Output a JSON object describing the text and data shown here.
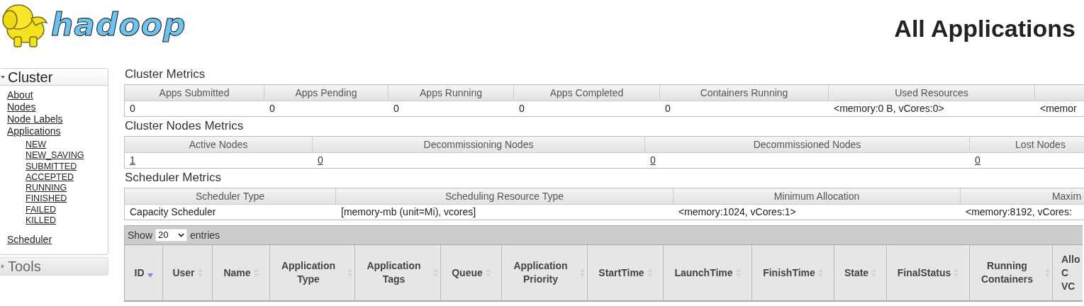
{
  "logo": {
    "text": "hadoop"
  },
  "page_title": "All Applications",
  "sidebar": {
    "sections": [
      {
        "title": "Cluster",
        "expanded": true,
        "items": [
          {
            "label": "About"
          },
          {
            "label": "Nodes"
          },
          {
            "label": "Node Labels"
          },
          {
            "label": "Applications",
            "children": [
              {
                "label": "NEW"
              },
              {
                "label": "NEW_SAVING"
              },
              {
                "label": "SUBMITTED"
              },
              {
                "label": "ACCEPTED"
              },
              {
                "label": "RUNNING"
              },
              {
                "label": "FINISHED"
              },
              {
                "label": "FAILED"
              },
              {
                "label": "KILLED"
              }
            ]
          },
          {
            "label": "Scheduler"
          }
        ]
      },
      {
        "title": "Tools",
        "expanded": false
      }
    ]
  },
  "metrics": [
    {
      "title": "Cluster Metrics",
      "values_are_links": false,
      "columns": [
        "Apps Submitted",
        "Apps Pending",
        "Apps Running",
        "Apps Completed",
        "Containers Running",
        "Used Resources"
      ],
      "row": [
        "0",
        "0",
        "0",
        "0",
        "0",
        "<memory:0 B, vCores:0>",
        "<memor"
      ]
    },
    {
      "title": "Cluster Nodes Metrics",
      "values_are_links": true,
      "columns": [
        "Active Nodes",
        "Decommissioning Nodes",
        "Decommissioned Nodes",
        "Lost Nodes"
      ],
      "row": [
        "1",
        "0",
        "0",
        "0"
      ]
    },
    {
      "title": "Scheduler Metrics",
      "values_are_links": false,
      "columns": [
        "Scheduler Type",
        "Scheduling Resource Type",
        "Minimum Allocation",
        "Maxim"
      ],
      "row": [
        "Capacity Scheduler",
        "[memory-mb (unit=Mi), vcores]",
        "<memory:1024, vCores:1>",
        "<memory:8192, vCores:"
      ]
    }
  ],
  "applications": {
    "show_entries": {
      "before": "Show",
      "value": "20",
      "after": "entries"
    },
    "columns": [
      {
        "label": "ID",
        "sorted": true
      },
      {
        "label": "User",
        "sorted": false
      },
      {
        "label": "Name",
        "sorted": false
      },
      {
        "label": "Application Type",
        "sorted": false
      },
      {
        "label": "Application Tags",
        "sorted": false
      },
      {
        "label": "Queue",
        "sorted": false
      },
      {
        "label": "Application Priority",
        "sorted": false
      },
      {
        "label": "StartTime",
        "sorted": false
      },
      {
        "label": "LaunchTime",
        "sorted": false
      },
      {
        "label": "FinishTime",
        "sorted": false
      },
      {
        "label": "State",
        "sorted": false
      },
      {
        "label": "FinalStatus",
        "sorted": false
      },
      {
        "label": "Running Containers",
        "sorted": false
      },
      {
        "label": "Allo\nC\nVC"
      }
    ]
  }
}
